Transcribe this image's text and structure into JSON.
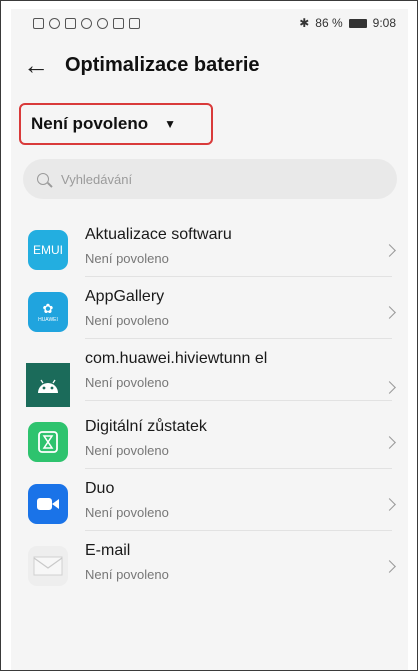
{
  "status_bar": {
    "battery_text": "86 %",
    "time": "9:08"
  },
  "header": {
    "title": "Optimalizace baterie"
  },
  "filter": {
    "label": "Není povoleno"
  },
  "search": {
    "placeholder": "Vyhledávání"
  },
  "apps": [
    {
      "name": "Aktualizace softwaru",
      "status": "Není povoleno",
      "icon": "emui-icon",
      "icon_text": "EMUI",
      "color": "#1fa8d9"
    },
    {
      "name": "AppGallery",
      "status": "Není povoleno",
      "icon": "appgallery-icon",
      "icon_text": "HUAWEI",
      "color": "#1aa0d8"
    },
    {
      "name": "com.huawei.hiviewtunn el",
      "status": "Není povoleno",
      "icon": "android-icon",
      "color": "#1b6b5a"
    },
    {
      "name": "Digitální zůstatek",
      "status": "Není povoleno",
      "icon": "hourglass-icon",
      "color": "#2ec36e"
    },
    {
      "name": "Duo",
      "status": "Není povoleno",
      "icon": "video-camera-icon",
      "color": "#1a73e8"
    },
    {
      "name": "E-mail",
      "status": "Není povoleno",
      "icon": "envelope-icon",
      "color": "#eeeeee"
    }
  ]
}
